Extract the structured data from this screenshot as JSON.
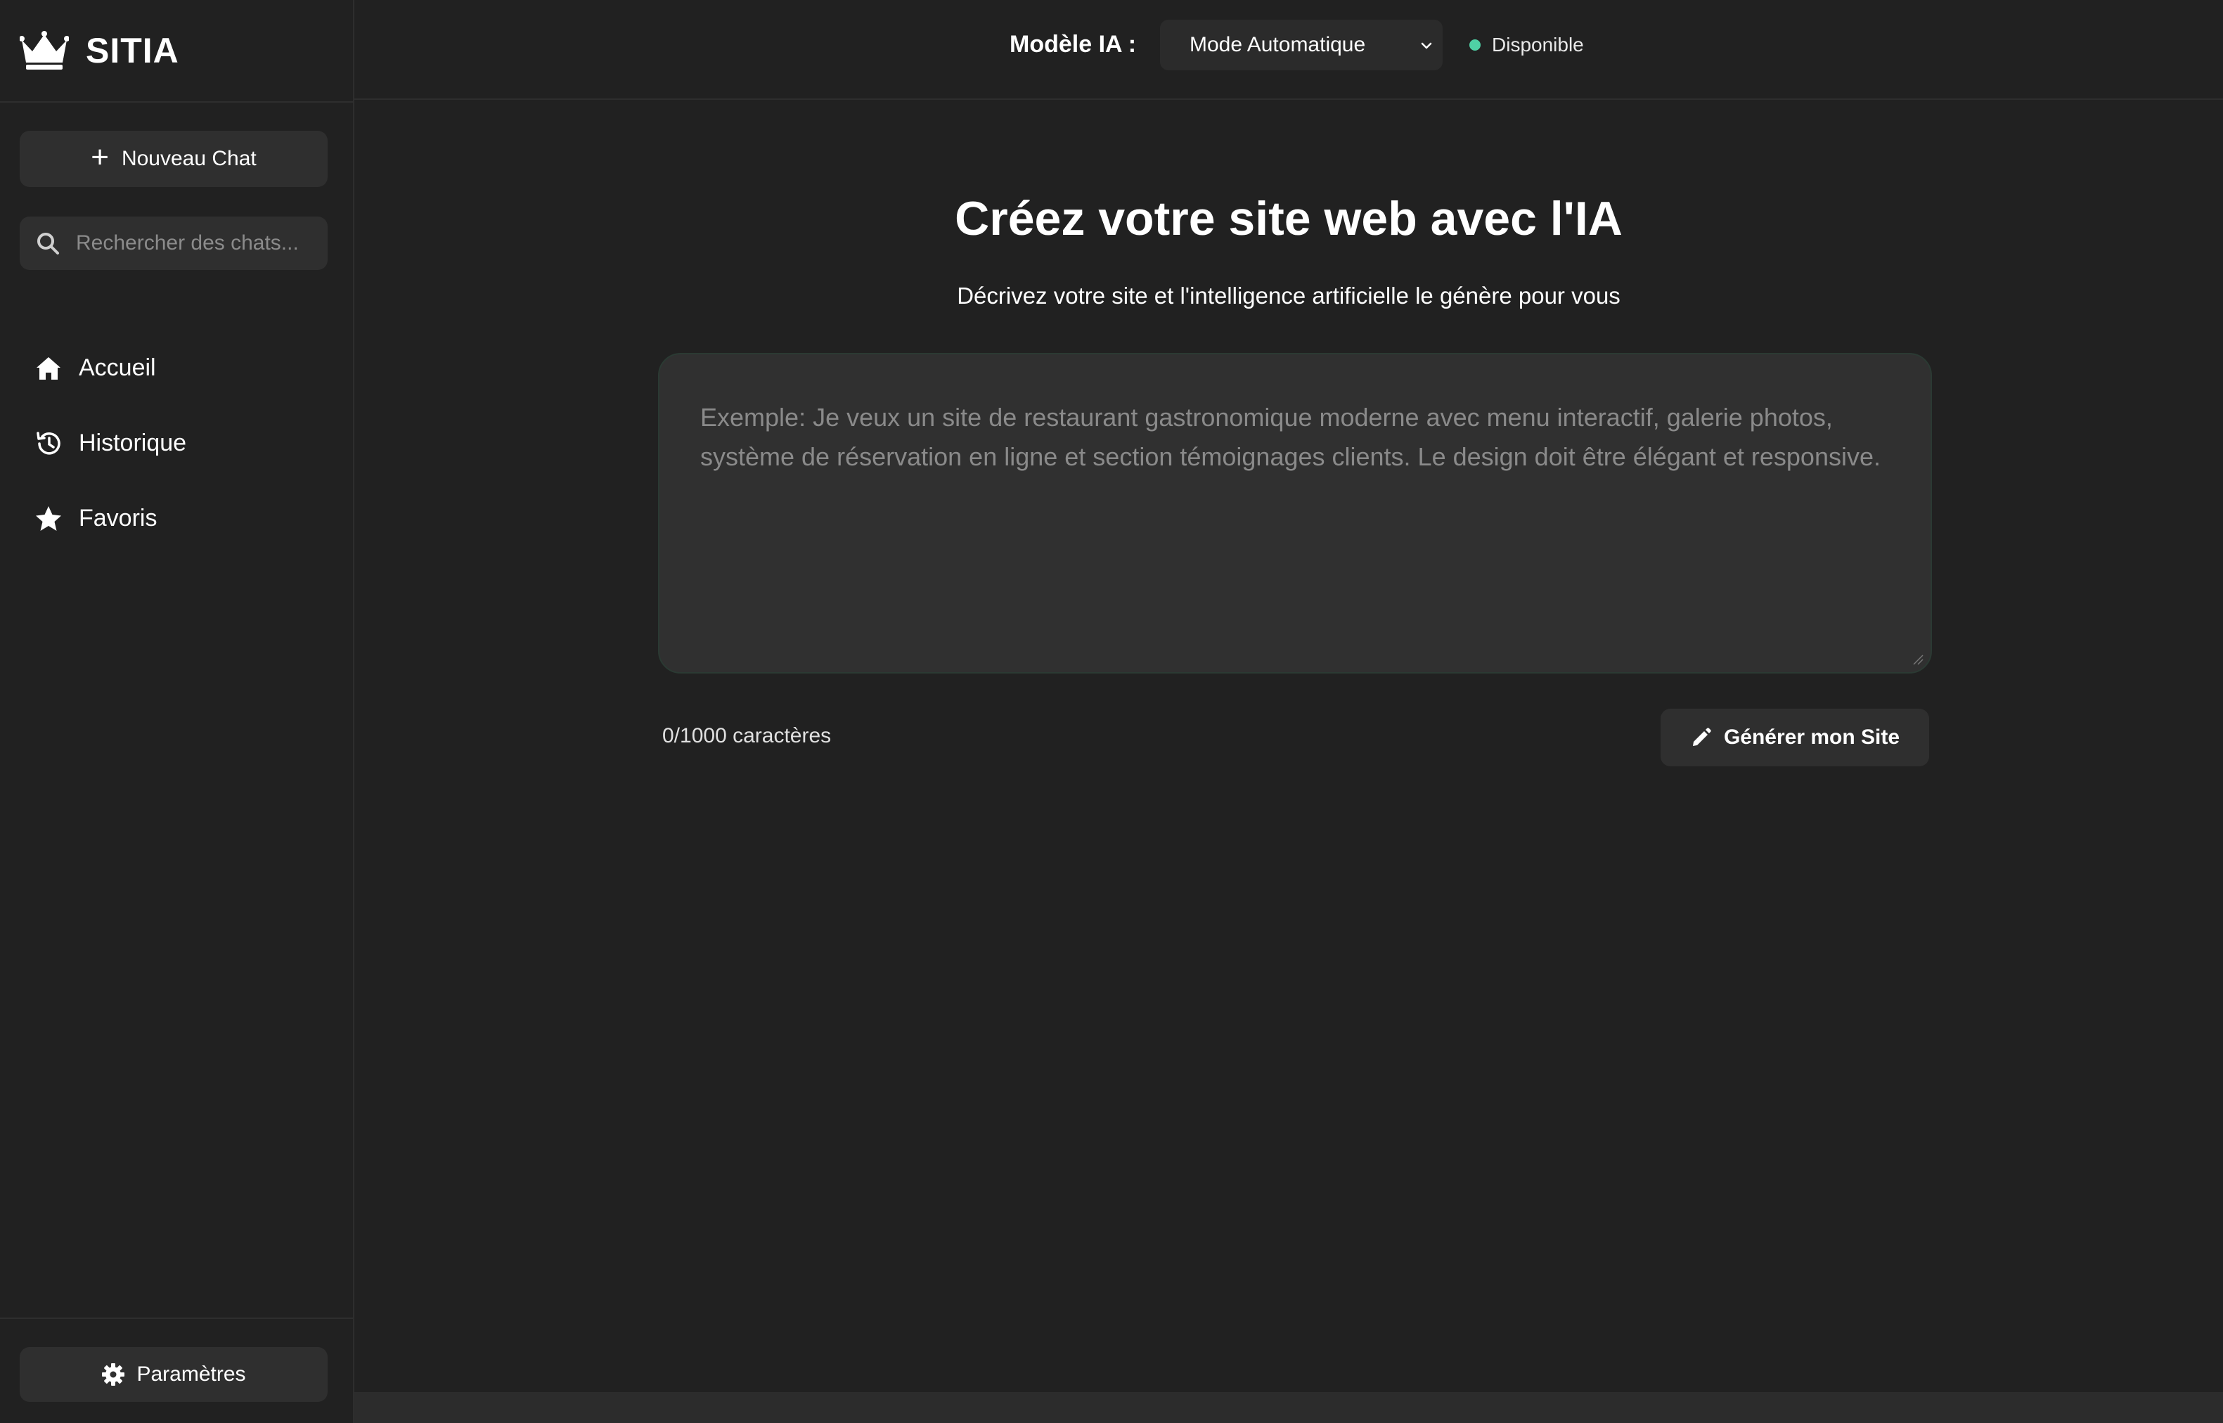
{
  "brand": {
    "name": "SITIA",
    "icon": "crown-icon"
  },
  "sidebar": {
    "new_chat_label": "Nouveau Chat",
    "search_placeholder": "Rechercher des chats...",
    "items": [
      {
        "label": "Accueil",
        "icon": "home-icon"
      },
      {
        "label": "Historique",
        "icon": "history-icon"
      },
      {
        "label": "Favoris",
        "icon": "star-icon"
      }
    ],
    "settings_label": "Paramètres"
  },
  "topbar": {
    "model_label": "Modèle IA :",
    "model_selected": "Mode Automatique",
    "status_text": "Disponible",
    "status_color": "#4fd1a5"
  },
  "main": {
    "title": "Créez votre site web avec l'IA",
    "subtitle": "Décrivez votre site et l'intelligence artificielle le génère pour vous",
    "prompt_value": "",
    "prompt_placeholder": "Exemple: Je veux un site de restaurant gastronomique moderne avec menu interactif, galerie photos, système de réservation en ligne et section témoignages clients. Le design doit être élégant et responsive.",
    "char_count": "0/1000 caractères",
    "generate_label": "Générer mon Site"
  }
}
